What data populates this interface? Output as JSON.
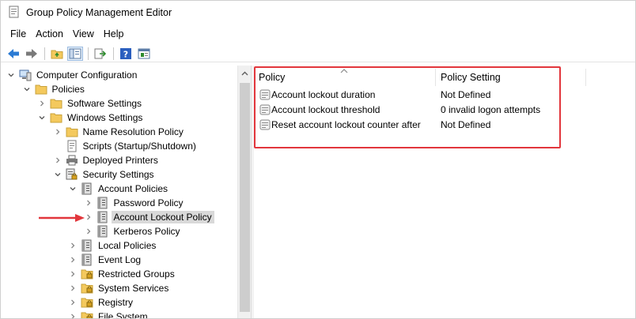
{
  "window": {
    "title": "Group Policy Management Editor"
  },
  "menu": [
    "File",
    "Action",
    "View",
    "Help"
  ],
  "toolbar": {
    "buttons": [
      "back-icon",
      "forward-icon",
      "up-folder-icon",
      "show-hide-tree-icon",
      "export-list-icon",
      "help-icon",
      "properties-icon"
    ]
  },
  "tree": {
    "items": [
      {
        "label": "Computer Configuration",
        "level": 0,
        "expander": "expanded",
        "icon": "computer-icon"
      },
      {
        "label": "Policies",
        "level": 1,
        "expander": "expanded",
        "icon": "folder-icon"
      },
      {
        "label": "Software Settings",
        "level": 2,
        "expander": "collapsed",
        "icon": "folder-icon"
      },
      {
        "label": "Windows Settings",
        "level": 2,
        "expander": "expanded",
        "icon": "folder-icon"
      },
      {
        "label": "Name Resolution Policy",
        "level": 3,
        "expander": "collapsed",
        "icon": "folder-icon"
      },
      {
        "label": "Scripts (Startup/Shutdown)",
        "level": 3,
        "expander": "none",
        "icon": "scripts-icon"
      },
      {
        "label": "Deployed Printers",
        "level": 3,
        "expander": "collapsed",
        "icon": "printer-icon"
      },
      {
        "label": "Security Settings",
        "level": 3,
        "expander": "expanded",
        "icon": "security-settings-icon"
      },
      {
        "label": "Account Policies",
        "level": 4,
        "expander": "expanded",
        "icon": "policy-book-icon"
      },
      {
        "label": "Password Policy",
        "level": 5,
        "expander": "collapsed",
        "icon": "policy-book-icon"
      },
      {
        "label": "Account Lockout Policy",
        "level": 5,
        "expander": "collapsed",
        "icon": "policy-book-icon",
        "selected": true
      },
      {
        "label": "Kerberos Policy",
        "level": 5,
        "expander": "collapsed",
        "icon": "policy-book-icon"
      },
      {
        "label": "Local Policies",
        "level": 4,
        "expander": "collapsed",
        "icon": "policy-book-icon"
      },
      {
        "label": "Event Log",
        "level": 4,
        "expander": "collapsed",
        "icon": "policy-book-icon"
      },
      {
        "label": "Restricted Groups",
        "level": 4,
        "expander": "collapsed",
        "icon": "locked-folder-icon"
      },
      {
        "label": "System Services",
        "level": 4,
        "expander": "collapsed",
        "icon": "locked-folder-icon"
      },
      {
        "label": "Registry",
        "level": 4,
        "expander": "collapsed",
        "icon": "locked-folder-icon"
      },
      {
        "label": "File System",
        "level": 4,
        "expander": "collapsed",
        "icon": "locked-folder-icon"
      }
    ]
  },
  "list": {
    "columns": [
      "Policy",
      "Policy Setting"
    ],
    "rows": [
      {
        "policy": "Account lockout duration",
        "setting": "Not Defined"
      },
      {
        "policy": "Account lockout threshold",
        "setting": "0 invalid logon attempts"
      },
      {
        "policy": "Reset account lockout counter after",
        "setting": "Not Defined"
      }
    ]
  },
  "colors": {
    "highlight": "#e2363c",
    "selection": "#d9d9d9",
    "folder": "#f4c95d"
  }
}
